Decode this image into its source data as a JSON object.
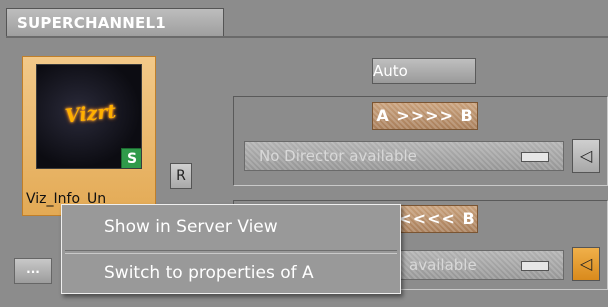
{
  "header": {
    "channel_tab": "SUPERCHANNEL1"
  },
  "thumbnail": {
    "caption": "Viz_Info_Un",
    "logo_text": "Vizrt",
    "badge": "S"
  },
  "buttons": {
    "r_label": "R",
    "more_label": "...",
    "auto_label": "Auto"
  },
  "directors": [
    {
      "transition_label": "A >>>> B",
      "select_value": "No Director available"
    },
    {
      "transition_label": "<<<< B",
      "select_value": "available"
    }
  ],
  "context_menu": {
    "items": [
      {
        "label": "Show in Server View"
      },
      {
        "label": "Switch to properties of A"
      }
    ]
  },
  "colors": {
    "background": "#8c8c8c",
    "selected_card": "#f2c989",
    "transition_button": "#b88f68",
    "active_triangle": "#f0b04a",
    "menu_background": "#999999"
  },
  "icons": [
    "s-badge-icon",
    "triangle-left-icon"
  ]
}
